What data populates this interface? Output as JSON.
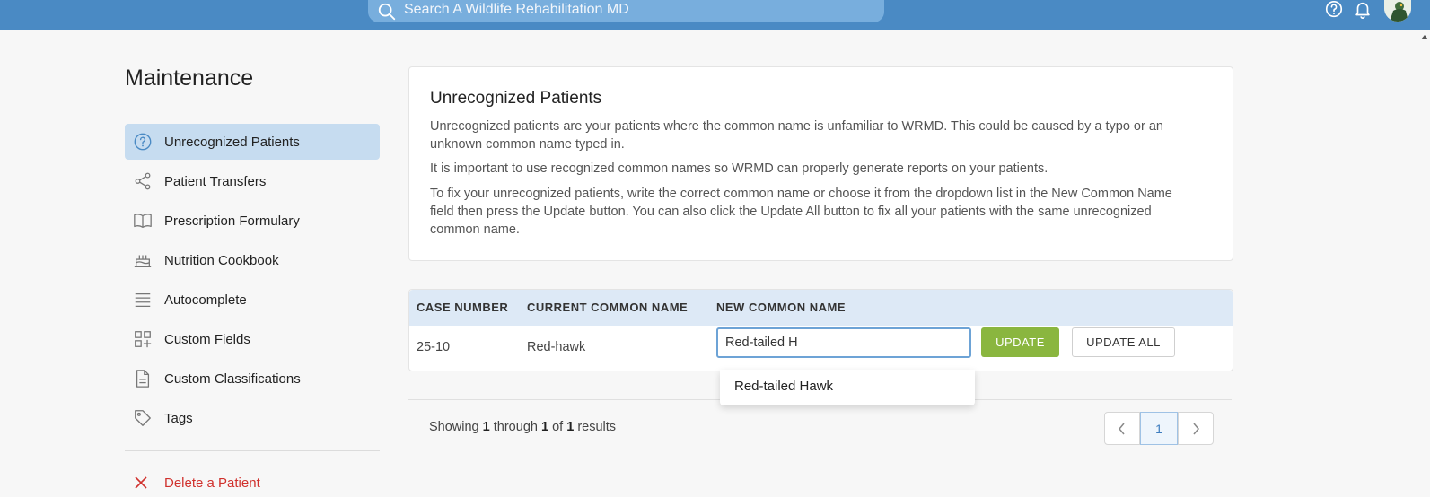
{
  "search": {
    "placeholder": "Search A Wildlife Rehabilitation MD"
  },
  "sidebar": {
    "title": "Maintenance",
    "items": [
      {
        "label": "Unrecognized Patients",
        "icon": "question-circle-icon",
        "active": true
      },
      {
        "label": "Patient Transfers",
        "icon": "share-icon"
      },
      {
        "label": "Prescription Formulary",
        "icon": "book-icon"
      },
      {
        "label": "Nutrition Cookbook",
        "icon": "cake-icon"
      },
      {
        "label": "Autocomplete",
        "icon": "lines-icon"
      },
      {
        "label": "Custom Fields",
        "icon": "grid-plus-icon"
      },
      {
        "label": "Custom Classifications",
        "icon": "document-icon"
      },
      {
        "label": "Tags",
        "icon": "tag-icon"
      }
    ],
    "delete_label": "Delete a Patient"
  },
  "card": {
    "title": "Unrecognized Patients",
    "para1": "Unrecognized patients are your patients where the common name is unfamiliar to WRMD. This could be caused by a typo or an unknown common name typed in.",
    "para2": "It is important to use recognized common names so WRMD can properly generate reports on your patients.",
    "para3": "To fix your unrecognized patients, write the correct common name or choose it from the dropdown list in the New Common Name field then press the Update button. You can also click the Update All button to fix all your patients with the same unrecognized common name."
  },
  "table": {
    "headers": [
      "CASE NUMBER",
      "CURRENT COMMON NAME",
      "NEW COMMON NAME"
    ],
    "rows": [
      {
        "case_number": "25-10",
        "current_common_name": "Red-hawk",
        "new_common_name": "Red-tailed H"
      }
    ],
    "update_label": "UPDATE",
    "update_all_label": "UPDATE ALL"
  },
  "dropdown": {
    "option": "Red-tailed Hawk"
  },
  "pagination": {
    "showing": "Showing",
    "from": "1",
    "through": "through",
    "to": "1",
    "of": "of",
    "total": "1",
    "results": "results",
    "current_page": "1"
  },
  "colors": {
    "topbar": "#4a8ac4",
    "active_nav": "#c6dcf0",
    "update_button": "#8ab63f",
    "delete_text": "#d0312d"
  }
}
